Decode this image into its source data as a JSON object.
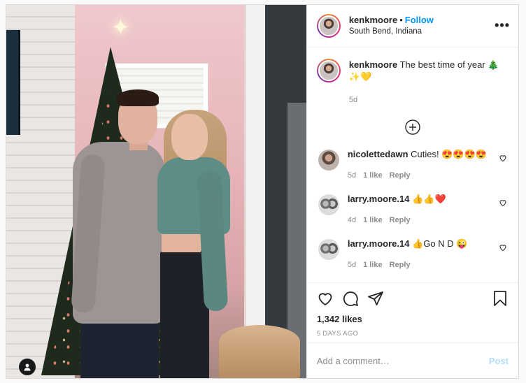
{
  "header": {
    "username": "kenkmoore",
    "separator": "•",
    "follow_label": "Follow",
    "location": "South Bend, Indiana",
    "more_label": "•••"
  },
  "caption": {
    "username": "kenkmoore",
    "text": "The best time of year 🎄✨💛",
    "time": "5d"
  },
  "comments": [
    {
      "username": "nicolettedawn",
      "text": "Cuties! 😍😍😍😍",
      "time": "5d",
      "likes": "1 like",
      "reply": "Reply"
    },
    {
      "username": "larry.moore.14",
      "text": "👍👍❤️",
      "time": "4d",
      "likes": "1 like",
      "reply": "Reply"
    },
    {
      "username": "larry.moore.14",
      "text": "👍Go N D 😜",
      "time": "5d",
      "likes": "1 like",
      "reply": "Reply"
    }
  ],
  "post_stats": {
    "likes": "1,342 likes",
    "age": "5 DAYS AGO"
  },
  "comment_box": {
    "placeholder": "Add a comment…",
    "post_label": "Post"
  },
  "icons": {
    "load_more": "plus-circle-icon",
    "like": "heart-icon",
    "comment": "comment-icon",
    "share": "share-icon",
    "save": "bookmark-icon",
    "tag": "user-tag-icon"
  },
  "colors": {
    "link": "#0095f6",
    "post_disabled": "#b2dffc",
    "muted": "#8e8e8e",
    "text": "#262626"
  }
}
